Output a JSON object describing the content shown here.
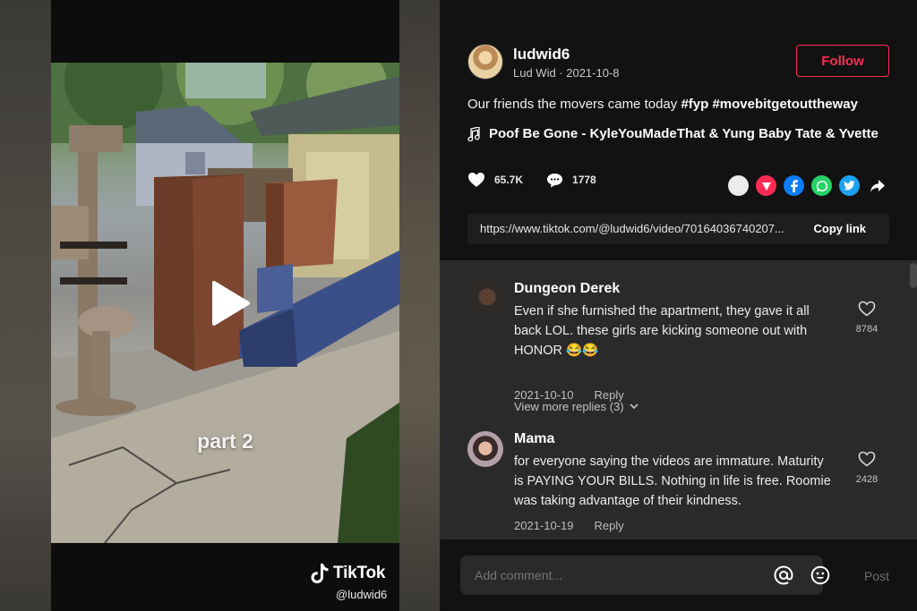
{
  "video": {
    "overlay_text": "part 2",
    "brand": "TikTok",
    "watermark_handle": "@ludwid6"
  },
  "author": {
    "username": "ludwid6",
    "subtitle": "Lud Wid · 2021-10-8",
    "follow_label": "Follow"
  },
  "post": {
    "caption_text": "Our friends the movers came today ",
    "hashtags": [
      "#fyp",
      "#movebitgetouttheway"
    ],
    "music": "Poof Be Gone - KyleYouMadeThat & Yung Baby Tate & Yvette",
    "likes": "65.7K",
    "comments": "1778",
    "share_icons": [
      "embed-icon",
      "send-icon",
      "facebook-icon",
      "whatsapp-icon",
      "twitter-icon",
      "share-arrow-icon"
    ],
    "link_url": "https://www.tiktok.com/@ludwid6/video/70164036740207...",
    "copy_link_label": "Copy link"
  },
  "comments": [
    {
      "name": "Dungeon Derek",
      "text": "Even if she furnished the apartment, they gave it all back LOL. these girls are kicking someone out with HONOR 😂😂",
      "date": "2021-10-10",
      "reply_label": "Reply",
      "likes": "8784",
      "view_replies": "View more replies (3)"
    },
    {
      "name": "Mama",
      "text": "for everyone saying the videos are immature. Maturity is PAYING YOUR BILLS. Nothing in life is free. Roomie was taking advantage of their kindness.",
      "date": "2021-10-19",
      "reply_label": "Reply",
      "likes": "2428"
    }
  ],
  "comment_bar": {
    "placeholder": "Add comment...",
    "post_label": "Post"
  },
  "colors": {
    "accent": "#fe2c55",
    "panel_bg": "#121212",
    "comments_bg": "#2a2a2a"
  }
}
